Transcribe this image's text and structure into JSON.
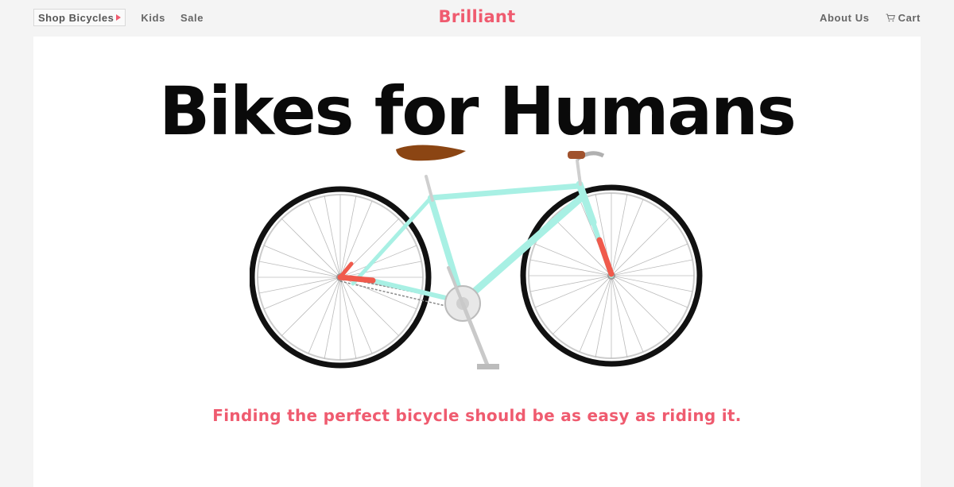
{
  "nav": {
    "shop_label": "Shop Bicycles",
    "kids_label": "Kids",
    "sale_label": "Sale",
    "about_label": "About Us",
    "cart_label": "Cart"
  },
  "brand": {
    "name": "Brilliant"
  },
  "hero": {
    "title": "Bikes for Humans",
    "tagline": "Finding the perfect bicycle should be as easy as riding it."
  },
  "colors": {
    "accent": "#ef5b6f",
    "frame": "#a8f0e4",
    "background": "#f4f4f4",
    "panel": "#ffffff"
  },
  "icons": {
    "shop_caret": "caret-right-icon",
    "cart": "cart-icon"
  }
}
